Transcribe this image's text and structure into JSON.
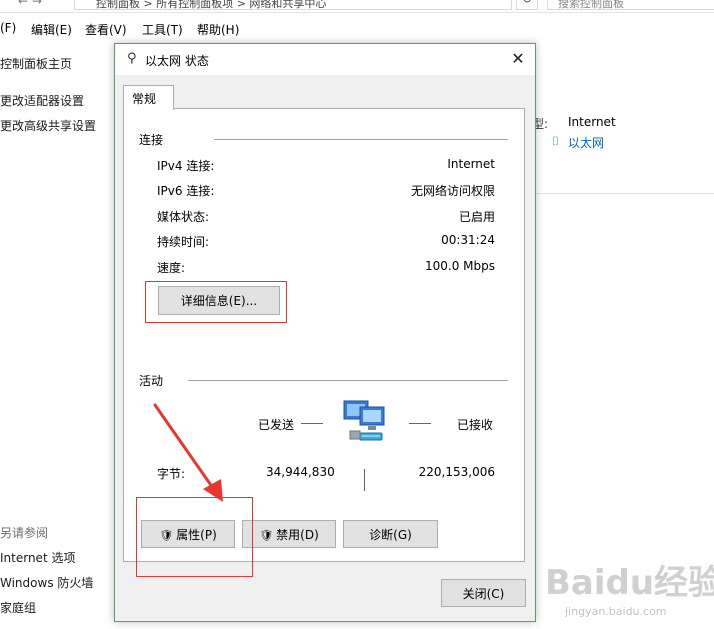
{
  "background": {
    "address_text": "控制面板 > 所有控制面板项 > 网络和共享中心",
    "search_placeholder": "搜索控制面板",
    "menus": [
      "(F)",
      "编辑(E)",
      "查看(V)",
      "工具(T)",
      "帮助(H)"
    ],
    "sidebar_links": [
      "控制面板主页",
      "更改适配器设置",
      "更改高级共享设置"
    ],
    "see_also_title": "另请参阅",
    "see_also_links": [
      "Internet 选项",
      "Windows 防火墙",
      "家庭组"
    ],
    "right_label": "型:",
    "right_value": "Internet",
    "right_link": "以太网"
  },
  "dialog": {
    "title": "以太网 状态",
    "close_glyph": "✕",
    "tab_label": "常规",
    "connection": {
      "title": "连接",
      "rows": [
        {
          "label": "IPv4 连接:",
          "value": "Internet"
        },
        {
          "label": "IPv6 连接:",
          "value": "无网络访问权限"
        },
        {
          "label": "媒体状态:",
          "value": "已启用"
        },
        {
          "label": "持续时间:",
          "value": "00:31:24"
        },
        {
          "label": "速度:",
          "value": "100.0 Mbps"
        }
      ],
      "details_button": "详细信息(E)..."
    },
    "activity": {
      "title": "活动",
      "sent_label": "已发送",
      "received_label": "已接收",
      "bytes_label": "字节:",
      "bytes_sent": "34,944,830",
      "bytes_received": "220,153,006"
    },
    "buttons": {
      "properties": "属性(P)",
      "disable": "禁用(D)",
      "diagnose": "诊断(G)",
      "close": "关闭(C)"
    }
  },
  "watermark": {
    "text": "Baidu经验",
    "sub": "jingyan.baidu.com"
  },
  "colors": {
    "dialog_border": "#5b9e6b",
    "highlight_red": "#e8372f",
    "link_blue": "#0066cc"
  }
}
